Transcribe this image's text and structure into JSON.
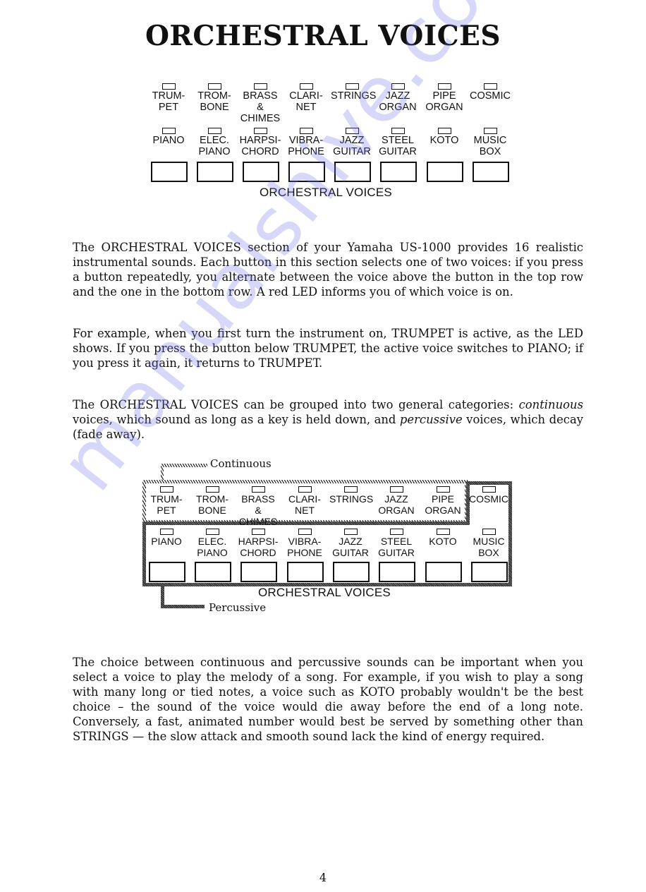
{
  "title": "ORCHESTRAL VOICES",
  "panel_top": {
    "top_row": [
      {
        "line1": "TRUM-",
        "line2": "PET"
      },
      {
        "line1": "TROM-",
        "line2": "BONE"
      },
      {
        "line1": "BRASS &",
        "line2": "CHIMES"
      },
      {
        "line1": "CLARI-",
        "line2": "NET"
      },
      {
        "line1": "STRINGS",
        "line2": ""
      },
      {
        "line1": "JAZZ",
        "line2": "ORGAN"
      },
      {
        "line1": "PIPE",
        "line2": "ORGAN"
      },
      {
        "line1": "COSMIC",
        "line2": ""
      }
    ],
    "bottom_row": [
      {
        "line1": "PIANO",
        "line2": ""
      },
      {
        "line1": "ELEC.",
        "line2": "PIANO"
      },
      {
        "line1": "HARPSI-",
        "line2": "CHORD"
      },
      {
        "line1": "VIBRA-",
        "line2": "PHONE"
      },
      {
        "line1": "JAZZ",
        "line2": "GUITAR"
      },
      {
        "line1": "STEEL",
        "line2": "GUITAR"
      },
      {
        "line1": "KOTO",
        "line2": ""
      },
      {
        "line1": "MUSIC",
        "line2": "BOX"
      }
    ],
    "caption": "ORCHESTRAL VOICES"
  },
  "paragraphs": {
    "p1": "The ORCHESTRAL VOICES section of your Yamaha US-1000 provides 16 realistic instrumental sounds. Each button in this section selects one of two voices: if you press a button repeatedly, you alternate between the voice above the button in the top row and the one in the bottom row. A red LED informs you of which voice is on.",
    "p2": "For example, when you first turn the instrument on, TRUMPET is active, as the LED shows. If you press the button below TRUMPET, the active voice switches to PIANO; if you press it again, it returns to TRUMPET.",
    "p3_a": "The ORCHESTRAL VOICES can be grouped into two general categories: ",
    "p3_b": "continuous",
    "p3_c": " voices, which sound as long as a key is held down, and ",
    "p3_d": "percussive",
    "p3_e": " voices, which decay (fade away).",
    "p4": "The choice between continuous and percussive sounds can be important when you select a voice to play the melody of a song. For example, if you wish to play a song with many long or tied notes, a voice such as KOTO probably wouldn't be the best choice – the sound of the voice would die away before the end of a long note. Conversely, a fast, animated number would best be served by something other than STRINGS — the slow attack and smooth sound lack the kind of energy required."
  },
  "panel_grouped": {
    "continuous_label": "Continuous",
    "percussive_label": "Percussive",
    "caption": "ORCHESTRAL VOICES"
  },
  "watermark": "manualshive.com",
  "page_number": "4"
}
